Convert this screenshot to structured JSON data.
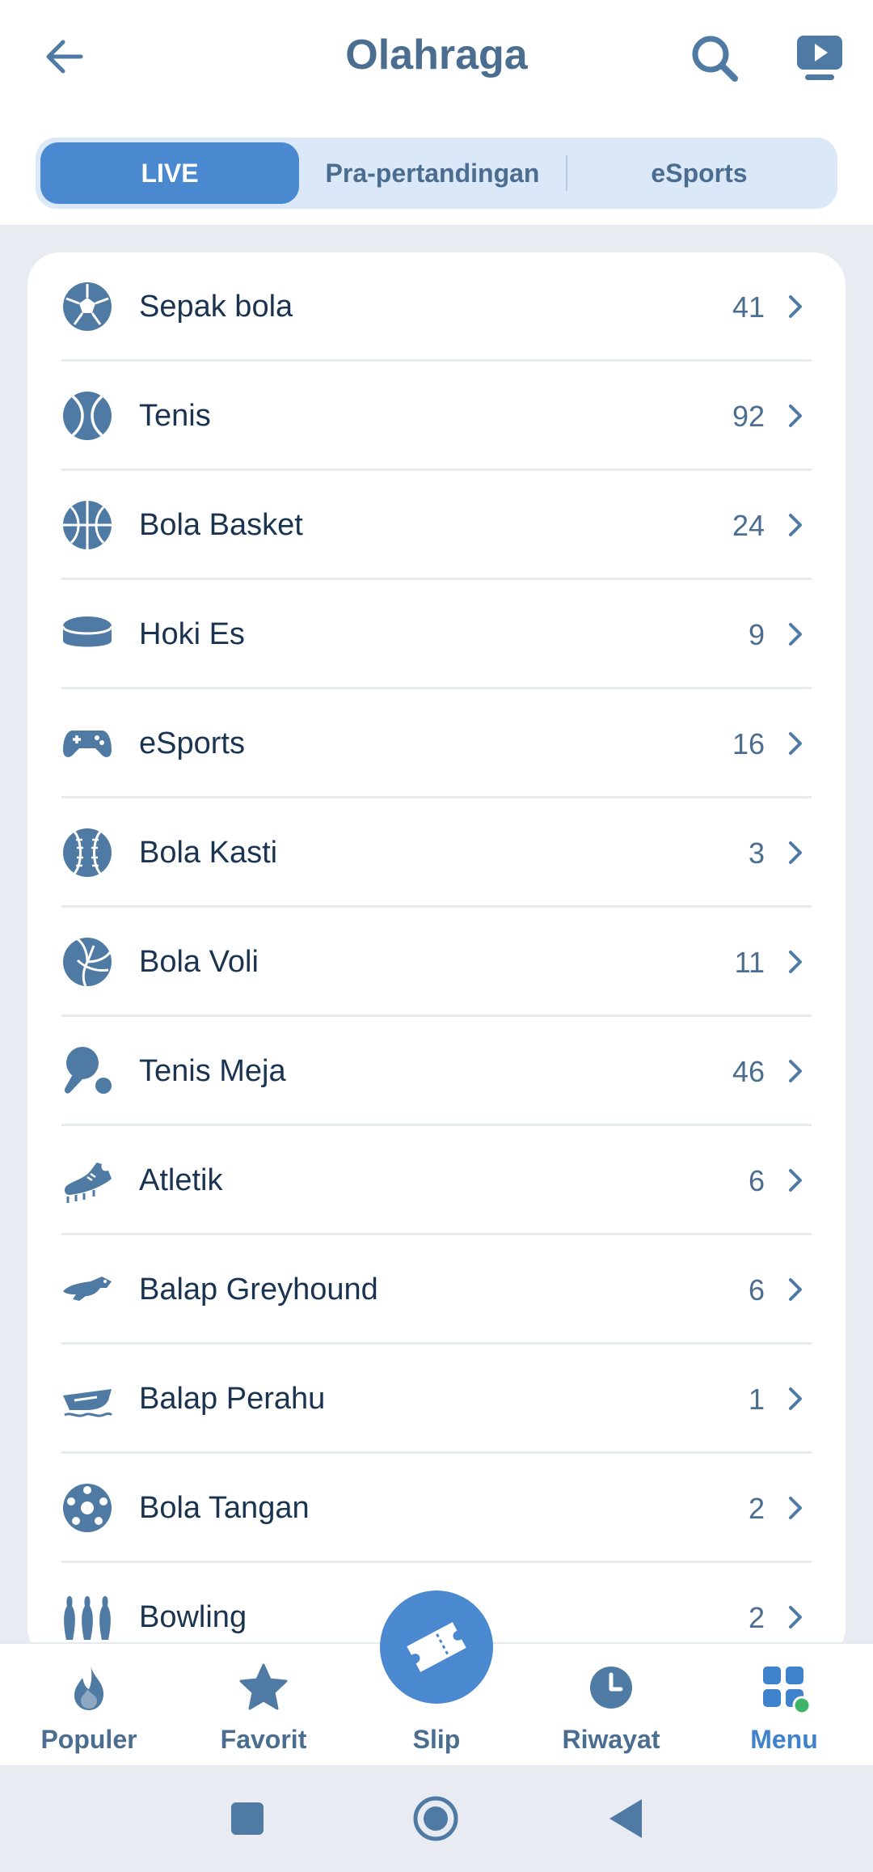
{
  "header": {
    "title": "Olahraga"
  },
  "tabs": [
    {
      "label": "LIVE",
      "active": true
    },
    {
      "label": "Pra-pertandingan",
      "active": false
    },
    {
      "label": "eSports",
      "active": false
    }
  ],
  "sports": [
    {
      "label": "Sepak bola",
      "count": "41",
      "icon": "soccer-ball-icon"
    },
    {
      "label": "Tenis",
      "count": "92",
      "icon": "tennis-ball-icon"
    },
    {
      "label": "Bola Basket",
      "count": "24",
      "icon": "basketball-icon"
    },
    {
      "label": "Hoki Es",
      "count": "9",
      "icon": "hockey-puck-icon"
    },
    {
      "label": "eSports",
      "count": "16",
      "icon": "gamepad-icon"
    },
    {
      "label": "Bola Kasti",
      "count": "3",
      "icon": "baseball-icon"
    },
    {
      "label": "Bola Voli",
      "count": "11",
      "icon": "volleyball-icon"
    },
    {
      "label": "Tenis Meja",
      "count": "46",
      "icon": "ping-pong-icon"
    },
    {
      "label": "Atletik",
      "count": "6",
      "icon": "running-shoe-icon"
    },
    {
      "label": "Balap Greyhound",
      "count": "6",
      "icon": "greyhound-icon"
    },
    {
      "label": "Balap Perahu",
      "count": "1",
      "icon": "boat-icon"
    },
    {
      "label": "Bola Tangan",
      "count": "2",
      "icon": "handball-icon"
    },
    {
      "label": "Bowling",
      "count": "2",
      "icon": "bowling-pins-icon"
    }
  ],
  "bottom_nav": [
    {
      "label": "Populer",
      "icon": "flame-icon"
    },
    {
      "label": "Favorit",
      "icon": "star-icon"
    },
    {
      "label": "Slip",
      "icon": "ticket-icon"
    },
    {
      "label": "Riwayat",
      "icon": "clock-icon"
    },
    {
      "label": "Menu",
      "icon": "grid-menu-icon",
      "active": true
    }
  ],
  "colors": {
    "primary": "#4a88cf",
    "text_dark": "#1a3350",
    "text_muted": "#4a6d90",
    "icon": "#4f7aa3",
    "background": "#e8ecf2",
    "status_dot": "#3fb56b"
  }
}
